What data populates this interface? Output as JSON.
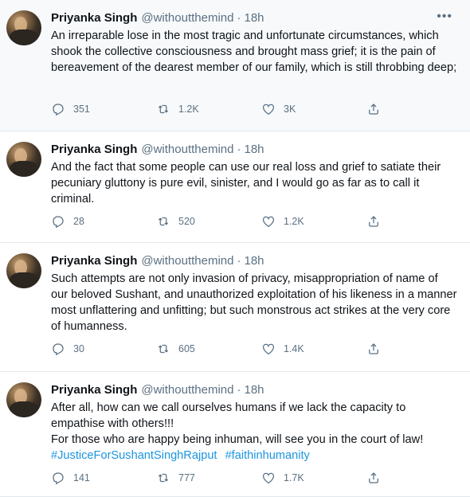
{
  "tweets": [
    {
      "name": "Priyanka Singh",
      "handle": "@withoutthemind",
      "separator": "·",
      "time": "18h",
      "text_lines": [
        "An irreparable lose in the most tragic and unfortunate circumstances, which shook the collective consciousness and brought mass grief; it is the pain of bereavement of the dearest member of our family, which is still throbbing deep;"
      ],
      "replies": "351",
      "retweets": "1.2K",
      "likes": "3K"
    },
    {
      "name": "Priyanka Singh",
      "handle": "@withoutthemind",
      "separator": "·",
      "time": "18h",
      "text_lines": [
        "And the fact that some people can use our real loss and grief to satiate their pecuniary gluttony is pure evil, sinister, and I would go as far as to call it criminal."
      ],
      "replies": "28",
      "retweets": "520",
      "likes": "1.2K"
    },
    {
      "name": "Priyanka Singh",
      "handle": "@withoutthemind",
      "separator": "·",
      "time": "18h",
      "text_lines": [
        "Such attempts are not only invasion of privacy, misappropriation of name of our beloved Sushant, and unauthorized exploitation of his likeness in a manner most unflattering and unfitting; but such monstrous act strikes at the very core of humanness."
      ],
      "replies": "30",
      "retweets": "605",
      "likes": "1.4K"
    },
    {
      "name": "Priyanka Singh",
      "handle": "@withoutthemind",
      "separator": "·",
      "time": "18h",
      "text_lines": [
        "After all, how can we call ourselves humans if we lack the capacity to empathise with others!!!",
        "For those who are happy being inhuman, will see you in the court of law!"
      ],
      "hashtags": [
        "#JusticeForSushantSinghRajput",
        "#faithinhumanity"
      ],
      "replies": "141",
      "retweets": "777",
      "likes": "1.7K"
    }
  ],
  "icons": {
    "reply": "reply-icon",
    "retweet": "retweet-icon",
    "like": "heart-icon",
    "share": "share-icon",
    "more": "more-icon"
  },
  "colors": {
    "text": "#0f1419",
    "secondary": "#5b7083",
    "link": "#1b95e0",
    "highlight_bg": "#f7f9fa",
    "divider": "#e1e8ed"
  }
}
